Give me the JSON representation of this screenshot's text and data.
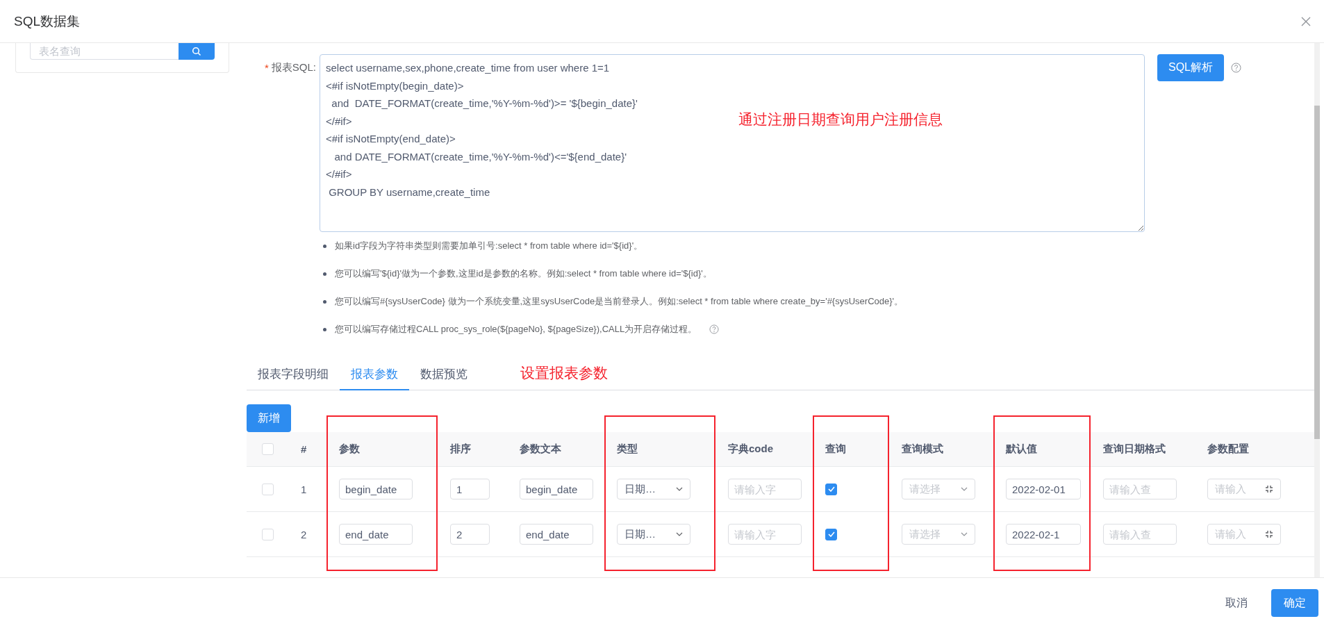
{
  "dialog": {
    "title": "SQL数据集"
  },
  "left_panel": {
    "search": {
      "placeholder": "表名查询"
    }
  },
  "sql_field": {
    "required_mark": "*",
    "label": "报表SQL:",
    "value": "select username,sex,phone,create_time from user where 1=1\n<#if isNotEmpty(begin_date)>\n  and  DATE_FORMAT(create_time,'%Y-%m-%d')>= '${begin_date}'\n</#if>\n<#if isNotEmpty(end_date)>\n   and DATE_FORMAT(create_time,'%Y-%m-%d')<='${end_date}'\n</#if>\n GROUP BY username,create_time",
    "annotation": "通过注册日期查询用户注册信息"
  },
  "parse_button": "SQL解析",
  "hints": [
    {
      "text": "如果id字段为字符串类型则需要加单引号:select * from table where id='${id}'。",
      "help": false
    },
    {
      "text": "您可以编写'${id}'做为一个参数,这里id是参数的名称。例如:select * from table where id='${id}'。",
      "help": false
    },
    {
      "text": "您可以编写#{sysUserCode} 做为一个系统变量,这里sysUserCode是当前登录人。例如:select * from table where create_by='#{sysUserCode}'。",
      "help": false
    },
    {
      "text": "您可以编写存储过程CALL proc_sys_role(${pageNo}, ${pageSize}),CALL为开启存储过程。",
      "help": true
    }
  ],
  "tabs": [
    {
      "label": "报表字段明细",
      "selected": false
    },
    {
      "label": "报表参数",
      "selected": true
    },
    {
      "label": "数据预览",
      "selected": false
    }
  ],
  "tabs_annotation": "设置报表参数",
  "add_button": "新增",
  "table": {
    "select_all": {
      "checked": false
    },
    "columns": [
      {
        "label": "#",
        "highlighted": false
      },
      {
        "label": "参数",
        "highlighted": true
      },
      {
        "label": "排序",
        "highlighted": false
      },
      {
        "label": "参数文本",
        "highlighted": false
      },
      {
        "label": "类型",
        "highlighted": true
      },
      {
        "label": "字典code",
        "highlighted": false
      },
      {
        "label": "查询",
        "highlighted": true
      },
      {
        "label": "查询模式",
        "highlighted": false
      },
      {
        "label": "默认值",
        "highlighted": true
      },
      {
        "label": "查询日期格式",
        "highlighted": false
      },
      {
        "label": "参数配置",
        "highlighted": false
      }
    ],
    "rows": [
      {
        "checked": false,
        "index": "1",
        "param": "begin_date",
        "order": "1",
        "text": "begin_date",
        "type": "日期…",
        "dict_placeholder": "请输入字",
        "query": true,
        "query_mode_placeholder": "请选择",
        "default": "2022-02-01",
        "date_format_placeholder": "请输入查",
        "config_placeholder": "请输入"
      },
      {
        "checked": false,
        "index": "2",
        "param": "end_date",
        "order": "2",
        "text": "end_date",
        "type": "日期…",
        "dict_placeholder": "请输入字",
        "query": true,
        "query_mode_placeholder": "请选择",
        "default": "2022-02-1",
        "date_format_placeholder": "请输入查",
        "config_placeholder": "请输入"
      }
    ]
  },
  "footer": {
    "cancel": "取消",
    "confirm": "确定"
  }
}
